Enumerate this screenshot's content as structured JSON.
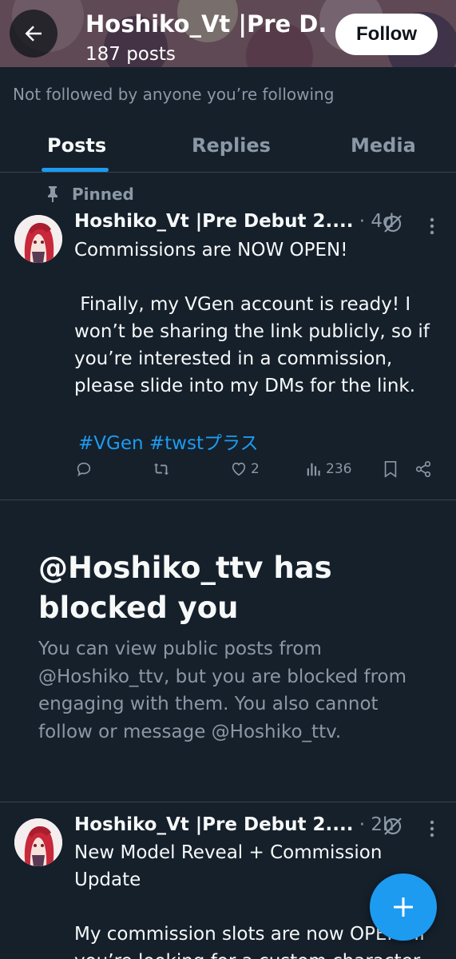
{
  "header": {
    "display_name": "Hoshiko_Vt |Pre D...",
    "post_count": "187 posts",
    "follow_label": "Follow"
  },
  "profile": {
    "followed_note": "Not followed by anyone you’re following"
  },
  "tabs": [
    {
      "label": "Posts",
      "active": true
    },
    {
      "label": "Replies",
      "active": false
    },
    {
      "label": "Media",
      "active": false
    }
  ],
  "posts": [
    {
      "pinned_label": "Pinned",
      "author": "Hoshiko_Vt |Pre Debut 2....",
      "time": " · 4d",
      "lines": [
        "Commissions are NOW OPEN!",
        "",
        " Finally, my VGen account is ready! I",
        "won’t be sharing the link publicly, so if",
        "you’re interested in a commission,",
        "please slide into my DMs for the link."
      ],
      "hashtags": "#VGen #twstプラス",
      "likes": "2",
      "views": "236"
    },
    {
      "author": "Hoshiko_Vt |Pre Debut 2....",
      "time": " · 2h",
      "lines": [
        "New Model Reveal + Commission",
        "Update",
        "",
        "My commission slots are now OPEN! If",
        "you’re looking for a custom character"
      ]
    }
  ],
  "blocked": {
    "title": "@Hoshiko_ttv has blocked you",
    "body": "You can view public posts from @Hoshiko_ttv, but you are blocked from engaging with them. You also cannot follow or message @Hoshiko_ttv."
  },
  "colors": {
    "background": "#15202b",
    "accent": "#1d9bf0",
    "muted_text": "#8b98a5",
    "divider": "#38444d"
  },
  "icons": [
    "back-arrow-icon",
    "pin-icon",
    "grok-icon",
    "more-icon",
    "reply-icon",
    "repost-icon",
    "like-icon",
    "views-icon",
    "bookmark-icon",
    "share-icon",
    "plus-icon"
  ]
}
